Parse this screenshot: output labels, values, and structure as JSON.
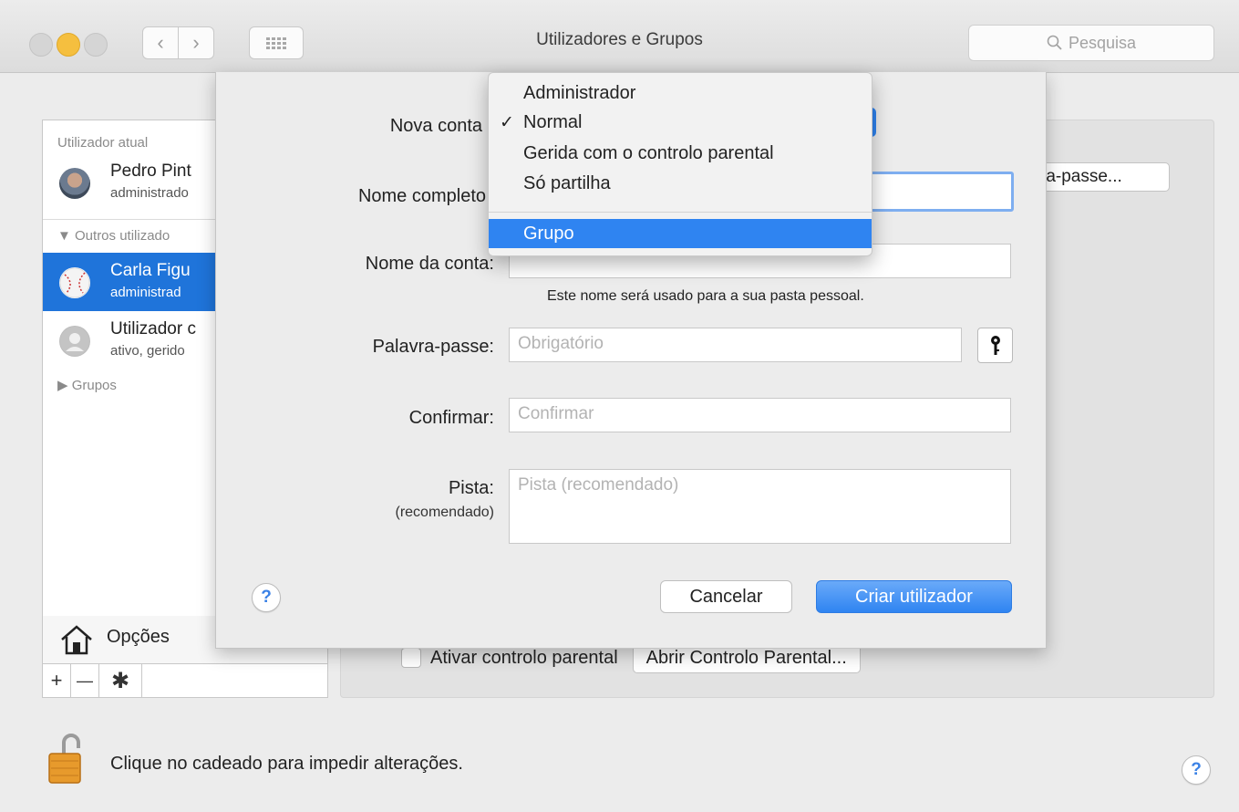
{
  "window": {
    "title": "Utilizadores e Grupos"
  },
  "toolbar": {
    "back_glyph": "‹",
    "forward_glyph": "›",
    "search_placeholder": "Pesquisa"
  },
  "sidebar": {
    "current_section": "Utilizador atual",
    "current_user": {
      "name": "Pedro Pint",
      "role": "administrado"
    },
    "others_section": "▼ Outros utilizado",
    "other_users": [
      {
        "name": "Carla Figu",
        "role": "administrad"
      },
      {
        "name": "Utilizador c",
        "role": "ativo, gerido"
      }
    ],
    "groups_section": "▶ Grupos",
    "options_label": "Opções",
    "add_glyph": "+",
    "remove_glyph": "—",
    "gear_glyph": "✱"
  },
  "background_panel": {
    "password_button": "ra-passe...",
    "parental_checkbox_label": "Ativar controlo parental",
    "parental_button": "Abrir Controlo Parental..."
  },
  "sheet": {
    "new_account_label": "Nova conta",
    "full_name_label": "Nome completo",
    "account_name_label": "Nome da conta:",
    "account_name_hint": "Este nome será usado para a sua pasta pessoal.",
    "password_label": "Palavra-passe:",
    "password_placeholder": "Obrigatório",
    "confirm_label": "Confirmar:",
    "confirm_placeholder": "Confirmar",
    "hint_label": "Pista:",
    "hint_sublabel": "(recomendado)",
    "hint_placeholder": "Pista (recomendado)",
    "help_glyph": "?",
    "cancel_label": "Cancelar",
    "create_label": "Criar utilizador"
  },
  "account_type_menu": {
    "check_glyph": "✓",
    "items": [
      {
        "label": "Administrador"
      },
      {
        "label": "Normal",
        "checked": true
      },
      {
        "label": "Gerida com o controlo parental"
      },
      {
        "label": "Só partilha"
      },
      {
        "label": "Grupo",
        "highlighted": true
      }
    ]
  },
  "footer": {
    "lock_text": "Clique no cadeado para impedir alterações.",
    "help_glyph": "?"
  },
  "colors": {
    "accent": "#2f84f1",
    "selection": "#1f74da",
    "traffic_yellow": "#f5bf3f"
  }
}
